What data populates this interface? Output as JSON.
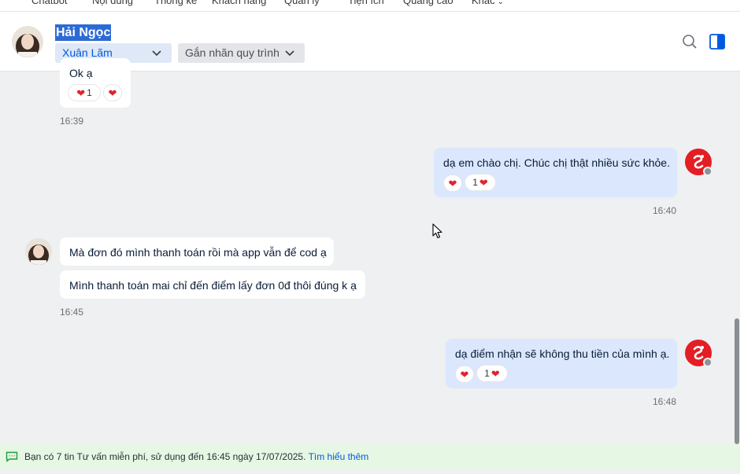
{
  "topnav": {
    "items": [
      "Chatbot",
      "Nội dung",
      "Thống kê",
      "Khách hàng",
      "Quản lý",
      "Tiện ích",
      "Quảng cáo",
      "Khác"
    ]
  },
  "header": {
    "contact_name": "Hải Ngọc",
    "assignee": "Xuân Lãm",
    "tag_placeholder": "Gắn nhãn quy trình",
    "icons": [
      "search-icon",
      "side-panel-icon"
    ]
  },
  "messages": [
    {
      "side": "in",
      "text": "Ok ạ",
      "reaction_count": "1",
      "time": "16:39"
    },
    {
      "side": "out",
      "text": "dạ em chào chị. Chúc chị thật nhiều sức khỏe.",
      "reaction_count": "1",
      "time": "16:40"
    },
    {
      "side": "in",
      "text": "Mà đơn đó mình thanh toán rồi mà app vẫn để cod ạ"
    },
    {
      "side": "in",
      "text": "Mình thanh toán mai chỉ đến điểm lấy đơn 0đ thôi đúng k ạ",
      "time": "16:45"
    },
    {
      "side": "out",
      "text": "dạ điểm nhận sẽ không thu tiền của mình ạ.",
      "reaction_count": "1",
      "time": "16:48"
    }
  ],
  "footer": {
    "message": "Bạn có 7 tin Tư vấn miễn phí, sử dụng đến 16:45 ngày 17/07/2025.",
    "link": "Tìm hiểu thêm"
  },
  "colors": {
    "accent": "#005ae0",
    "outgoing_bubble": "#dbe7fd",
    "heart": "#e0242b",
    "footer_bg": "#e6f7e4"
  }
}
